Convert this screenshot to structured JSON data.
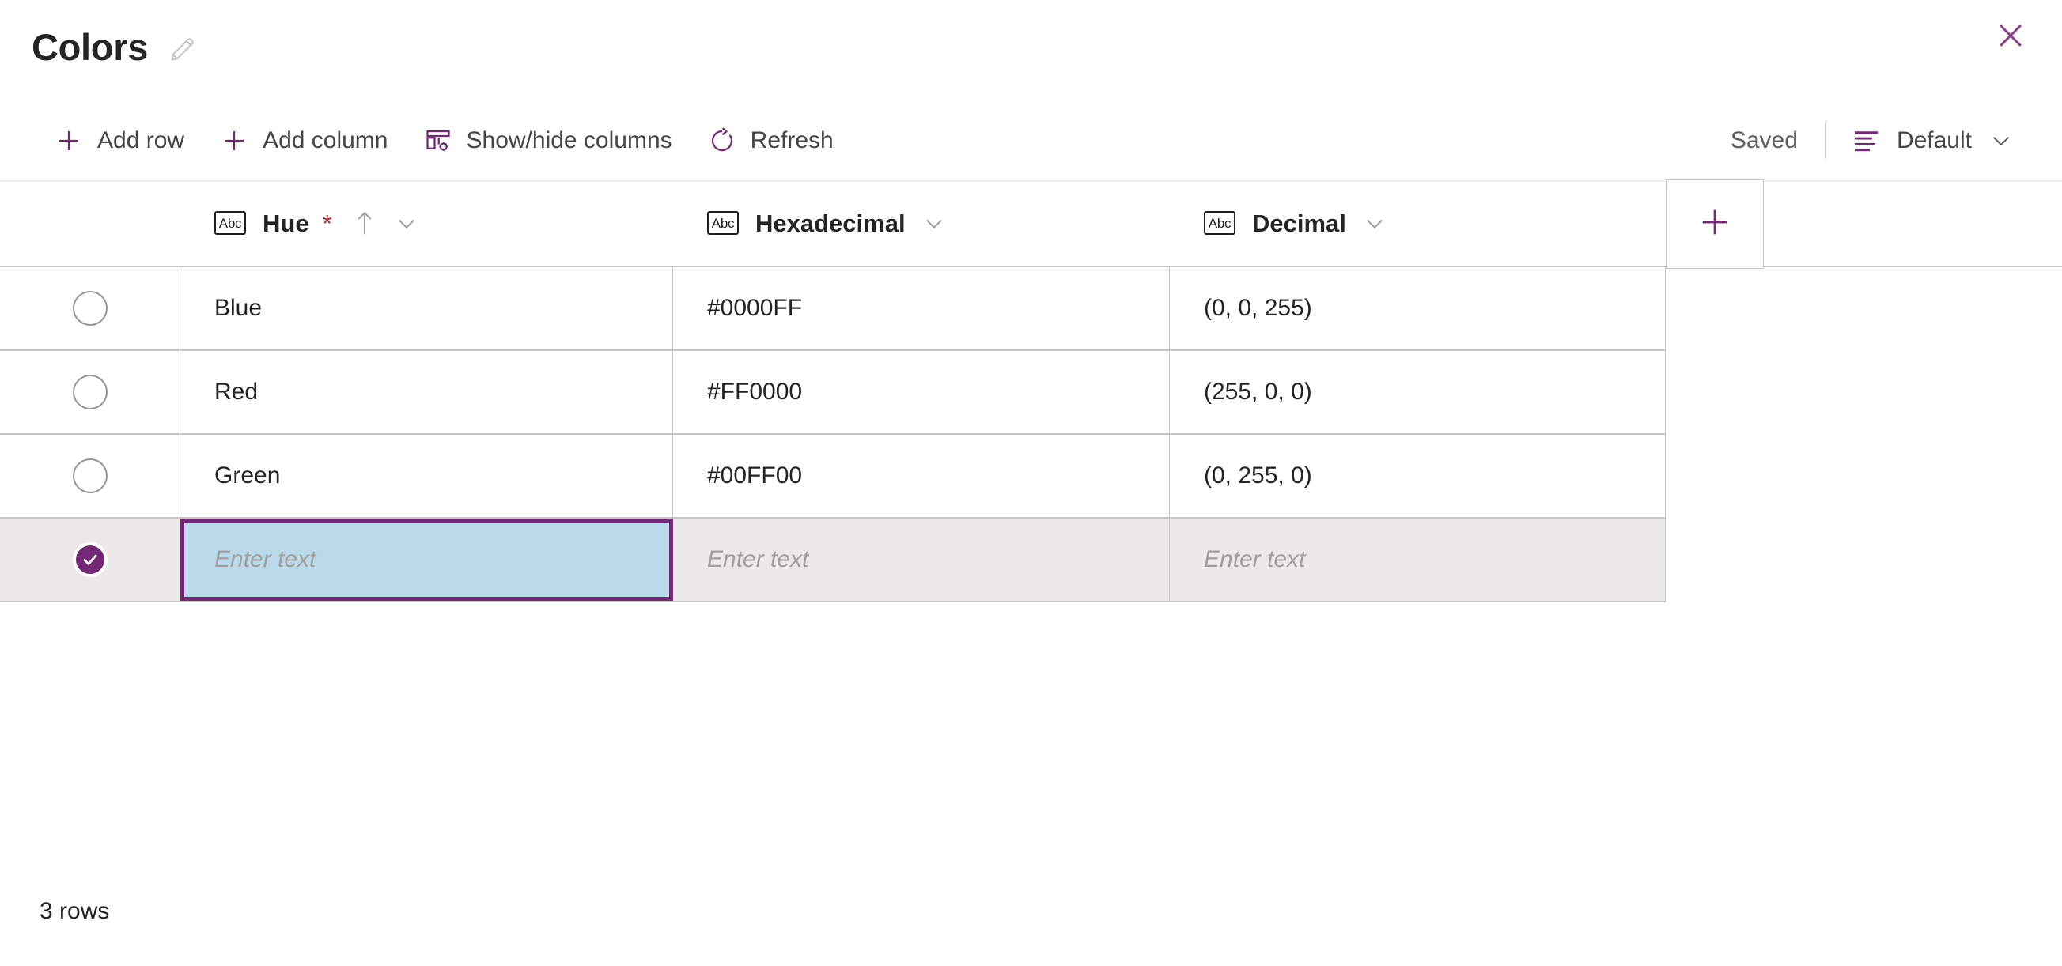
{
  "header": {
    "title": "Colors",
    "edit_icon": "pencil-icon",
    "close_icon": "close-icon"
  },
  "toolbar": {
    "add_row_label": "Add row",
    "add_column_label": "Add column",
    "show_hide_columns_label": "Show/hide columns",
    "refresh_label": "Refresh",
    "saved_status": "Saved",
    "view_label": "Default",
    "icons": {
      "add_row": "plus-icon",
      "add_column": "plus-icon",
      "show_hide_columns": "table-settings-icon",
      "refresh": "refresh-icon",
      "view": "list-view-icon",
      "view_chevron": "chevron-down-icon"
    }
  },
  "grid": {
    "columns": [
      {
        "label": "Hue",
        "type_icon": "Abc",
        "required": "*",
        "sorted": "ascending"
      },
      {
        "label": "Hexadecimal",
        "type_icon": "Abc",
        "required": "",
        "sorted": ""
      },
      {
        "label": "Decimal",
        "type_icon": "Abc",
        "required": "",
        "sorted": ""
      }
    ],
    "add_column_icon": "plus-icon",
    "rows": [
      {
        "hue": "Blue",
        "hexadecimal": "#0000FF",
        "decimal": "(0, 0, 255)",
        "selected": false
      },
      {
        "hue": "Red",
        "hexadecimal": "#FF0000",
        "decimal": "(255, 0, 0)",
        "selected": false
      },
      {
        "hue": "Green",
        "hexadecimal": "#00FF00",
        "decimal": "(0, 255, 0)",
        "selected": false
      }
    ],
    "new_row": {
      "selected": true,
      "hue_placeholder": "Enter text",
      "hue_value": "",
      "hexadecimal_placeholder": "Enter text",
      "decimal_placeholder": "Enter text"
    }
  },
  "footer": {
    "row_count_label": "3 rows"
  },
  "colors": {
    "accent_purple": "#742774",
    "required_red": "#a4262c",
    "grid_border": "#c8c6c4",
    "new_row_bg": "#ebeae8",
    "editing_cell_bg": "#bad9eb",
    "text_primary": "#242424",
    "text_secondary": "#605e5c"
  }
}
